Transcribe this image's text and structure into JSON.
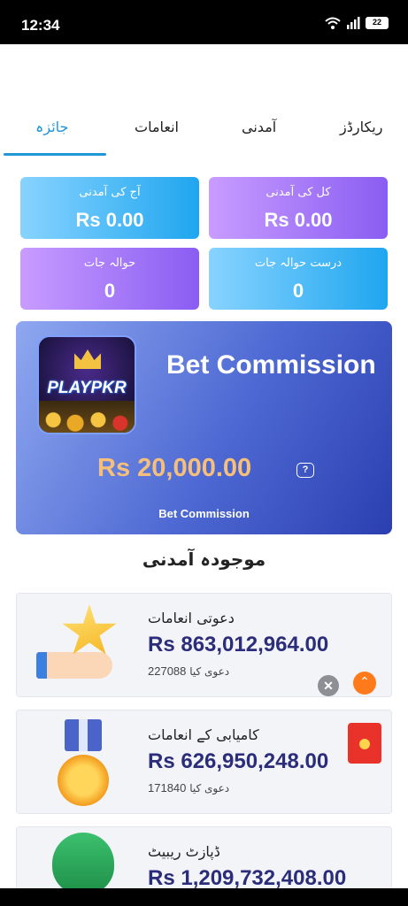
{
  "status_bar": {
    "time": "12:34",
    "battery": "22"
  },
  "tabs": [
    {
      "label": "جائزہ",
      "active": true
    },
    {
      "label": "انعامات",
      "active": false
    },
    {
      "label": "آمدنی",
      "active": false
    },
    {
      "label": "ریکارڈز",
      "active": false
    }
  ],
  "stats": {
    "today_income": {
      "label": "آج کی آمدنی",
      "value": "Rs 0.00"
    },
    "total_income": {
      "label": "کل کی آمدنی",
      "value": "Rs 0.00"
    },
    "referrals": {
      "label": "حوالہ جات",
      "value": "0"
    },
    "valid_referrals": {
      "label": "درست حوالہ جات",
      "value": "0"
    }
  },
  "banner": {
    "logo_text": "PLAYPKR",
    "title": "Bet Commission",
    "amount": "Rs 20,000.00",
    "help_icon": "?",
    "footer": "Bet Commission"
  },
  "section_title": "موجودہ آمدنی",
  "reward_cards": [
    {
      "title": "دعوتی انعامات",
      "amount": "Rs 863,012,964.00",
      "claimed_label": "دعوی کیا",
      "claimed_count": "227088",
      "icon": "star-hand-icon"
    },
    {
      "title": "کامیابی کے انعامات",
      "amount": "Rs 626,950,248.00",
      "claimed_label": "دعوی کیا",
      "claimed_count": "171840",
      "icon": "medal-icon"
    },
    {
      "title": "ڈپازٹ ریبیٹ",
      "amount": "Rs 1,209,732,408.00",
      "icon": "money-bag-icon"
    }
  ],
  "floating": {
    "close_icon": "✕",
    "scroll_top_icon": "⌃"
  },
  "colors": {
    "accent": "#2196d6",
    "amount_text": "#2b2d7a",
    "banner_amount": "#f7c07a"
  }
}
